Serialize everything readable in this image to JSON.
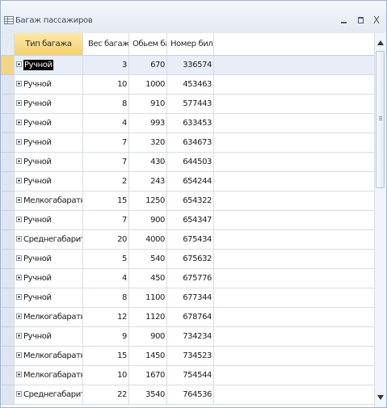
{
  "window": {
    "title": "Багаж пассажиров",
    "minimize_icon": "minimize-icon",
    "maximize_icon": "maximize-icon",
    "close_icon": "close-icon",
    "close_label": "X"
  },
  "table": {
    "columns": [
      "Тип багажа",
      "Вес багажа",
      "Обьем багажа (см",
      "Номер биле"
    ],
    "rows": [
      {
        "type": "Ручной",
        "weight": "3",
        "volume": "670",
        "ticket": "336574"
      },
      {
        "type": "Ручной",
        "weight": "10",
        "volume": "1000",
        "ticket": "453463"
      },
      {
        "type": "Ручной",
        "weight": "8",
        "volume": "910",
        "ticket": "577443"
      },
      {
        "type": "Ручной",
        "weight": "4",
        "volume": "993",
        "ticket": "633453"
      },
      {
        "type": "Ручной",
        "weight": "7",
        "volume": "320",
        "ticket": "634673"
      },
      {
        "type": "Ручной",
        "weight": "7",
        "volume": "430",
        "ticket": "644503"
      },
      {
        "type": "Ручной",
        "weight": "2",
        "volume": "243",
        "ticket": "654244"
      },
      {
        "type": "Мелкогабаратный",
        "weight": "15",
        "volume": "1250",
        "ticket": "654322"
      },
      {
        "type": "Ручной",
        "weight": "7",
        "volume": "900",
        "ticket": "654347"
      },
      {
        "type": "Среднегабаритный",
        "weight": "20",
        "volume": "4000",
        "ticket": "675434"
      },
      {
        "type": "Ручной",
        "weight": "5",
        "volume": "540",
        "ticket": "675632"
      },
      {
        "type": "Ручной",
        "weight": "4",
        "volume": "450",
        "ticket": "675776"
      },
      {
        "type": "Ручной",
        "weight": "8",
        "volume": "1100",
        "ticket": "677344"
      },
      {
        "type": "Мелкогабаратный",
        "weight": "12",
        "volume": "1120",
        "ticket": "678764"
      },
      {
        "type": "Ручной",
        "weight": "9",
        "volume": "900",
        "ticket": "734234"
      },
      {
        "type": "Мелкогабаратный",
        "weight": "15",
        "volume": "1450",
        "ticket": "734523"
      },
      {
        "type": "Мелкогабаратный",
        "weight": "10",
        "volume": "1670",
        "ticket": "754544"
      },
      {
        "type": "Среднегабаритный",
        "weight": "22",
        "volume": "3540",
        "ticket": "764536"
      }
    ],
    "current_row": 0
  },
  "colors": {
    "header_active": "#f6cf6c",
    "selector": "#dde6f2",
    "border": "#d7dde6"
  }
}
